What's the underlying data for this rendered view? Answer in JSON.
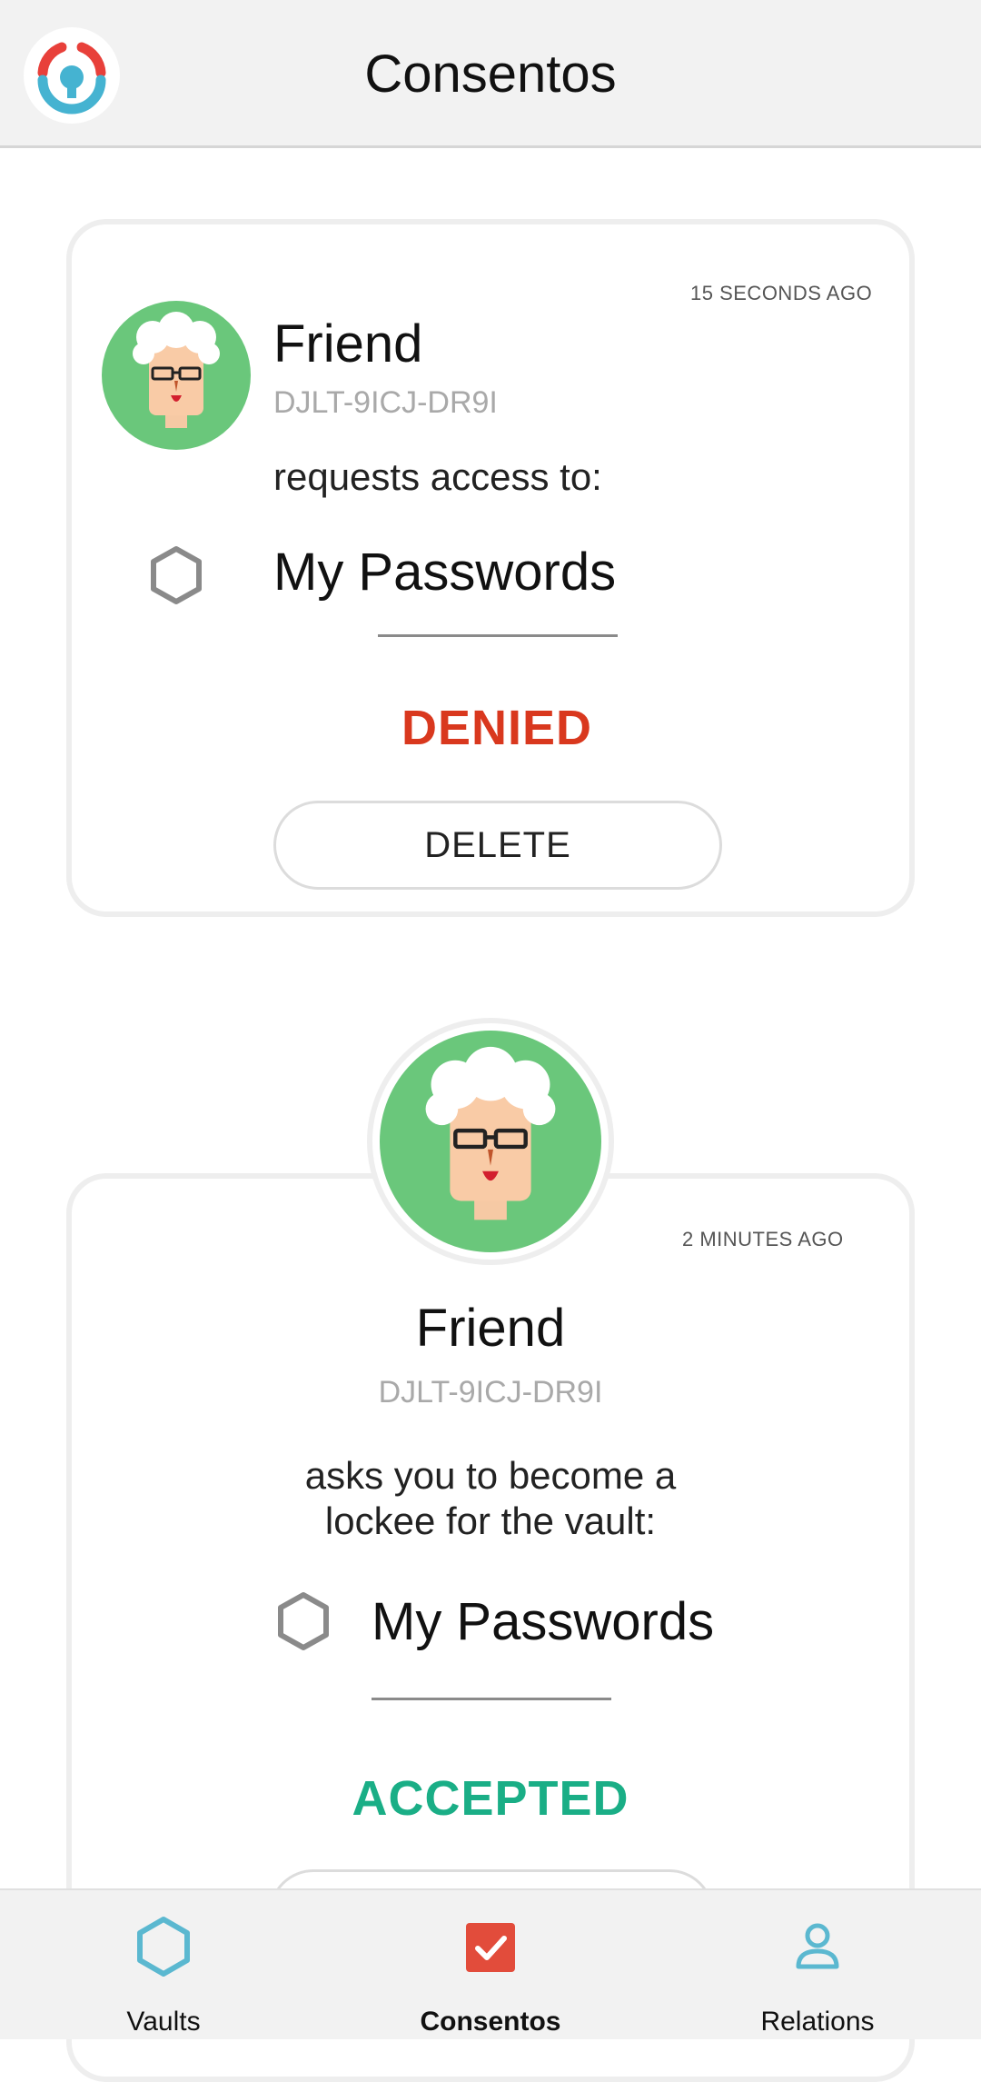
{
  "header": {
    "title": "Consentos"
  },
  "cards": [
    {
      "timestamp": "15 SECONDS AGO",
      "name": "Friend",
      "code": "DJLT-9ICJ-DR9I",
      "description": "requests access to:",
      "vault": "My Passwords",
      "status": "DENIED",
      "button": "DELETE"
    },
    {
      "timestamp": "2 MINUTES AGO",
      "name": "Friend",
      "code": "DJLT-9ICJ-DR9I",
      "description_line1": "asks you to become a",
      "description_line2": "lockee for the vault:",
      "vault": "My Passwords",
      "status": "ACCEPTED"
    }
  ],
  "colors": {
    "denied": "#d9381e",
    "accepted": "#1aae86",
    "avatar_bg": "#6ac77b",
    "nav_icon": "#5bb8d0",
    "consent_icon": "#e24c3b"
  },
  "nav": {
    "items": [
      {
        "label": "Vaults",
        "icon": "hexagon-icon"
      },
      {
        "label": "Consentos",
        "icon": "check-box-icon",
        "active": true
      },
      {
        "label": "Relations",
        "icon": "person-icon"
      }
    ]
  }
}
